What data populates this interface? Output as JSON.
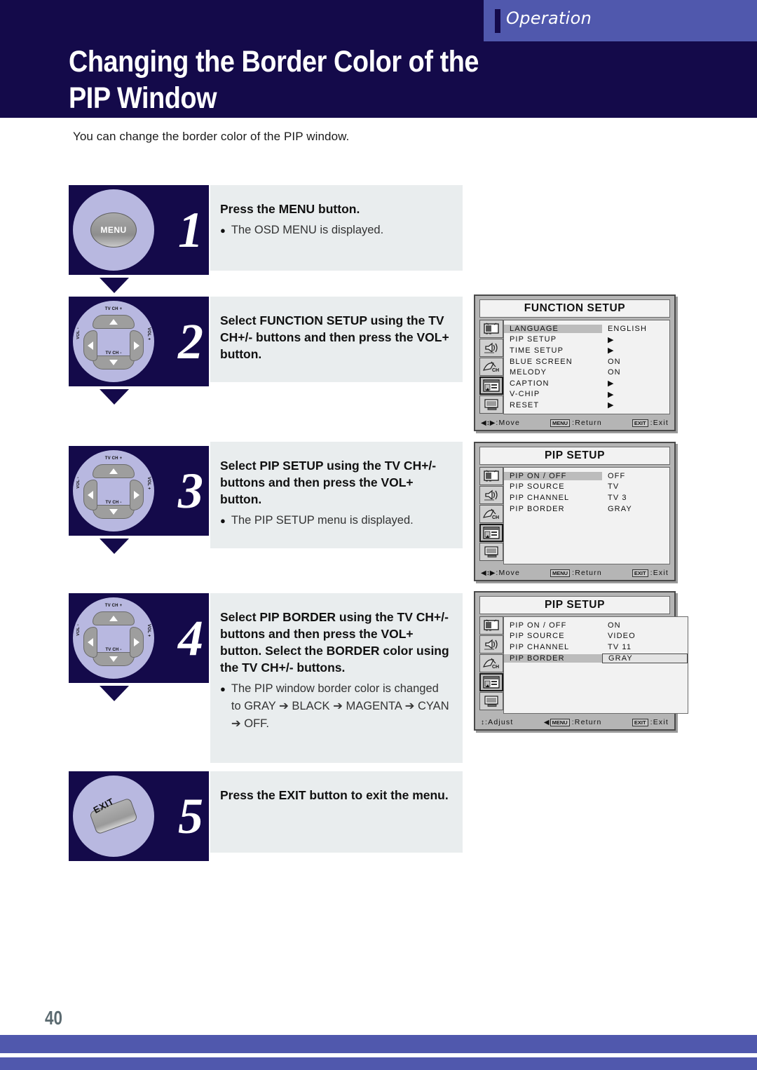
{
  "header": {
    "section_label": "Operation",
    "title_line1": "Changing the Border Color of the",
    "title_line2": "PIP Window"
  },
  "intro": "You can change the border color of the PIP window.",
  "steps": [
    {
      "number": "1",
      "icon": "menu-button",
      "icon_label": "MENU",
      "title": "Press the MENU button.",
      "bullets": [
        "The OSD MENU is displayed."
      ]
    },
    {
      "number": "2",
      "icon": "dpad",
      "title": "Select FUNCTION SETUP using the TV CH+/- buttons and then press the VOL+ button.",
      "bullets": []
    },
    {
      "number": "3",
      "icon": "dpad",
      "title": "Select PIP SETUP using the TV CH+/- buttons and then press the VOL+ button.",
      "bullets": [
        "The PIP SETUP menu is displayed."
      ]
    },
    {
      "number": "4",
      "icon": "dpad",
      "title": "Select PIP BORDER using the TV CH+/- buttons and then press the VOL+ button. Select the BORDER color using the TV CH+/- buttons.",
      "bullets": [
        "The  PIP window border color is changed to GRAY ➔ BLACK ➔ MAGENTA ➔ CYAN ➔ OFF."
      ]
    },
    {
      "number": "5",
      "icon": "exit-button",
      "icon_label": "EXIT",
      "title": "Press the EXIT button to exit the menu.",
      "bullets": []
    }
  ],
  "dpad_labels": {
    "up": "TV CH +",
    "down": "TV CH -",
    "left": "VOL -",
    "right": "VOL +"
  },
  "osd_menus": [
    {
      "title": "FUNCTION SETUP",
      "rows": [
        {
          "label": "LANGUAGE",
          "value": "ENGLISH",
          "highlight": true,
          "boxed": false
        },
        {
          "label": "PIP SETUP",
          "value": "▶",
          "highlight": false,
          "boxed": false
        },
        {
          "label": "TIME SETUP",
          "value": "▶",
          "highlight": false,
          "boxed": false
        },
        {
          "label": "BLUE SCREEN",
          "value": "ON",
          "highlight": false,
          "boxed": false
        },
        {
          "label": "MELODY",
          "value": "ON",
          "highlight": false,
          "boxed": false
        },
        {
          "label": "CAPTION",
          "value": "▶",
          "highlight": false,
          "boxed": false
        },
        {
          "label": "V-CHIP",
          "value": "▶",
          "highlight": false,
          "boxed": false
        },
        {
          "label": "RESET",
          "value": "▶",
          "highlight": false,
          "boxed": false
        }
      ],
      "footer": {
        "nav_glyph": "◀↕▶",
        "nav_label": ":Move",
        "return_key": "MENU",
        "return_label": ":Return",
        "exit_key": "EXIT",
        "exit_label": ":Exit",
        "return_prefix": ""
      },
      "selected_icon_index": 3
    },
    {
      "title": "PIP SETUP",
      "rows": [
        {
          "label": "PIP ON / OFF",
          "value": "OFF",
          "highlight": true,
          "boxed": false
        },
        {
          "label": "PIP SOURCE",
          "value": "TV",
          "highlight": false,
          "boxed": false
        },
        {
          "label": "PIP CHANNEL",
          "value": "TV 3",
          "highlight": false,
          "boxed": false
        },
        {
          "label": "PIP BORDER",
          "value": "GRAY",
          "highlight": false,
          "boxed": false
        }
      ],
      "footer": {
        "nav_glyph": "◀↕▶",
        "nav_label": ":Move",
        "return_key": "MENU",
        "return_label": ":Return",
        "exit_key": "EXIT",
        "exit_label": ":Exit",
        "return_prefix": ""
      },
      "selected_icon_index": 3
    },
    {
      "title": "PIP SETUP",
      "rows": [
        {
          "label": "PIP ON / OFF",
          "value": "ON",
          "highlight": false,
          "boxed": false
        },
        {
          "label": "PIP SOURCE",
          "value": "VIDEO",
          "highlight": false,
          "boxed": false
        },
        {
          "label": "PIP CHANNEL",
          "value": "TV 11",
          "highlight": false,
          "boxed": false
        },
        {
          "label": "PIP BORDER",
          "value": "GRAY",
          "highlight": true,
          "boxed": true
        }
      ],
      "footer": {
        "nav_glyph": "↕",
        "nav_label": ":Adjust",
        "return_key": "MENU",
        "return_label": ":Return",
        "exit_key": "EXIT",
        "exit_label": ":Exit",
        "return_prefix": "◀"
      },
      "selected_icon_index": 3
    }
  ],
  "footer": {
    "page_number": "40"
  },
  "colors": {
    "navy": "#140A4A",
    "accent": "#5058AD",
    "knob": "#b8b8e0",
    "panel": "#e9edee"
  }
}
